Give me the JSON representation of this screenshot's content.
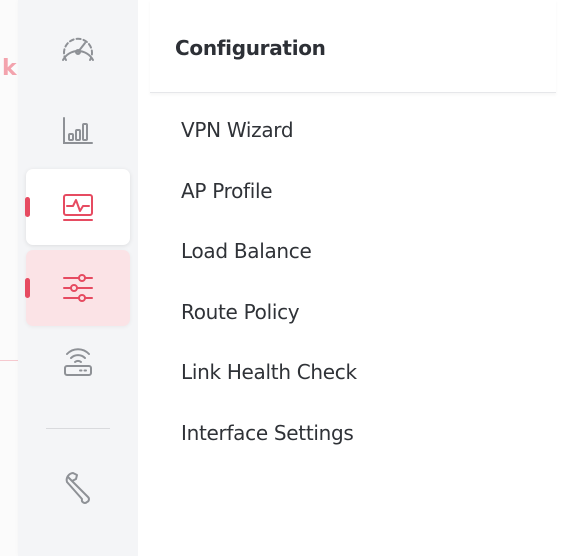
{
  "submenu": {
    "title": "Configuration",
    "items": [
      {
        "label": "VPN Wizard"
      },
      {
        "label": "AP Profile"
      },
      {
        "label": "Load Balance"
      },
      {
        "label": "Route Policy"
      },
      {
        "label": "Link Health Check"
      },
      {
        "label": "Interface Settings"
      }
    ]
  },
  "rail": {
    "items": [
      {
        "icon": "speedometer-icon",
        "state": "default"
      },
      {
        "icon": "bar-chart-icon",
        "state": "default"
      },
      {
        "icon": "monitor-pulse-icon",
        "state": "hovered"
      },
      {
        "icon": "sliders-icon",
        "state": "active"
      },
      {
        "icon": "wireless-router-icon",
        "state": "default"
      },
      {
        "icon": "wrench-icon",
        "state": "default"
      }
    ]
  },
  "colors": {
    "accent": "#e64b61",
    "active_bg": "#fbe3e6",
    "icon_default": "#8e9196",
    "rail_bg": "#f4f5f7"
  }
}
